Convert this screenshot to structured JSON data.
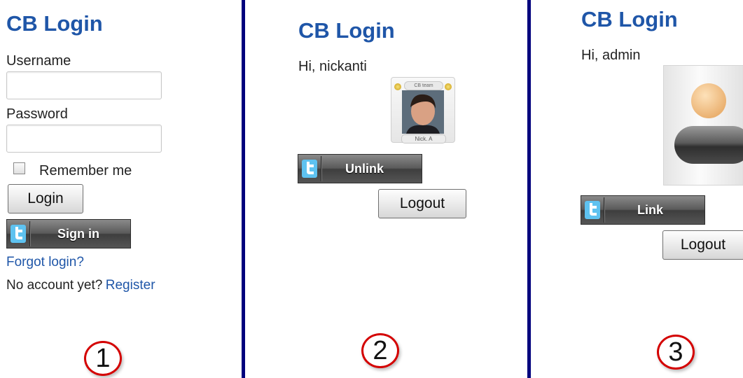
{
  "panels": [
    {
      "title": "CB Login",
      "username_label": "Username",
      "username_value": "",
      "password_label": "Password",
      "password_value": "",
      "remember_label": "Remember me",
      "login_label": "Login",
      "twitter_label": "Sign in",
      "forgot_link": "Forgot login?",
      "no_account_text": "No account yet?",
      "register_link": "Register",
      "number": "1"
    },
    {
      "title": "CB Login",
      "greeting": "Hi, nickanti",
      "avatar_caption_top": "CB team",
      "avatar_caption": "Nick. A",
      "twitter_label": "Unlink",
      "logout_label": "Logout",
      "number": "2"
    },
    {
      "title": "CB Login",
      "greeting": "Hi, admin",
      "twitter_label": "Link",
      "logout_label": "Logout",
      "number": "3"
    }
  ],
  "colors": {
    "title": "#1f56a8",
    "divider": "#00007d",
    "twitter_icon": "#5ec2f0",
    "circle_border": "#d40000"
  },
  "icons": [
    "twitter-icon",
    "user-photo",
    "default-avatar"
  ]
}
